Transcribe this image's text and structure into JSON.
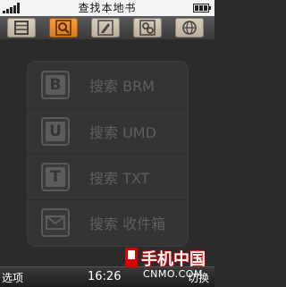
{
  "status_bar": {
    "title": "查找本地书",
    "signal_icon": "signal-bars-icon",
    "battery_icon": "battery-icon"
  },
  "tabs": [
    {
      "icon": "list-icon",
      "active": false
    },
    {
      "icon": "search-icon",
      "active": true
    },
    {
      "icon": "pencil-icon",
      "active": false
    },
    {
      "icon": "settings-circles-icon",
      "active": false
    },
    {
      "icon": "globe-icon",
      "active": false
    }
  ],
  "menu": {
    "items": [
      {
        "letter": "B",
        "label": "搜索 BRM"
      },
      {
        "letter": "U",
        "label": "搜索 UMD"
      },
      {
        "letter": "T",
        "label": "搜索 TXT"
      },
      {
        "icon": "envelope-icon",
        "label": "搜索 收件箱"
      }
    ]
  },
  "bottom_bar": {
    "left_softkey": "选项",
    "time": "16:26",
    "right_softkey": "切换"
  },
  "watermark": {
    "main": "手机中国",
    "sub": "CNMO.COM"
  },
  "colors": {
    "active_tab": "#e8902e",
    "inactive_tab": "#cfc5b3",
    "background": "#2b2b2b"
  }
}
